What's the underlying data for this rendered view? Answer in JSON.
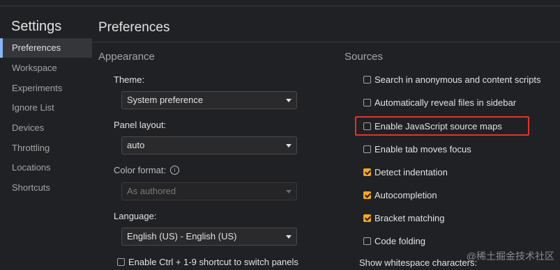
{
  "sidebar": {
    "title": "Settings",
    "items": [
      {
        "label": "Preferences"
      },
      {
        "label": "Workspace"
      },
      {
        "label": "Experiments"
      },
      {
        "label": "Ignore List"
      },
      {
        "label": "Devices"
      },
      {
        "label": "Throttling"
      },
      {
        "label": "Locations"
      },
      {
        "label": "Shortcuts"
      }
    ]
  },
  "main": {
    "title": "Preferences",
    "appearance": {
      "title": "Appearance",
      "theme_label": "Theme:",
      "theme_value": "System preference",
      "panel_layout_label": "Panel layout:",
      "panel_layout_value": "auto",
      "color_format_label": "Color format:",
      "color_format_value": "As authored",
      "language_label": "Language:",
      "language_value": "English (US) - English (US)",
      "ctrl_shortcut_label": "Enable Ctrl + 1-9 shortcut to switch panels"
    },
    "sources": {
      "title": "Sources",
      "options": [
        {
          "label": "Search in anonymous and content scripts",
          "checked": false
        },
        {
          "label": "Automatically reveal files in sidebar",
          "checked": false
        },
        {
          "label": "Enable JavaScript source maps",
          "checked": false
        },
        {
          "label": "Enable tab moves focus",
          "checked": false
        },
        {
          "label": "Detect indentation",
          "checked": true
        },
        {
          "label": "Autocompletion",
          "checked": true
        },
        {
          "label": "Bracket matching",
          "checked": true
        },
        {
          "label": "Code folding",
          "checked": false
        }
      ],
      "whitespace_label": "Show whitespace characters:"
    }
  },
  "watermark": "@稀土掘金技术社区",
  "colors": {
    "accent": "#8ab4f8",
    "checkbox_checked": "#f5a623",
    "highlight": "#e0352b",
    "background": "#202124"
  }
}
